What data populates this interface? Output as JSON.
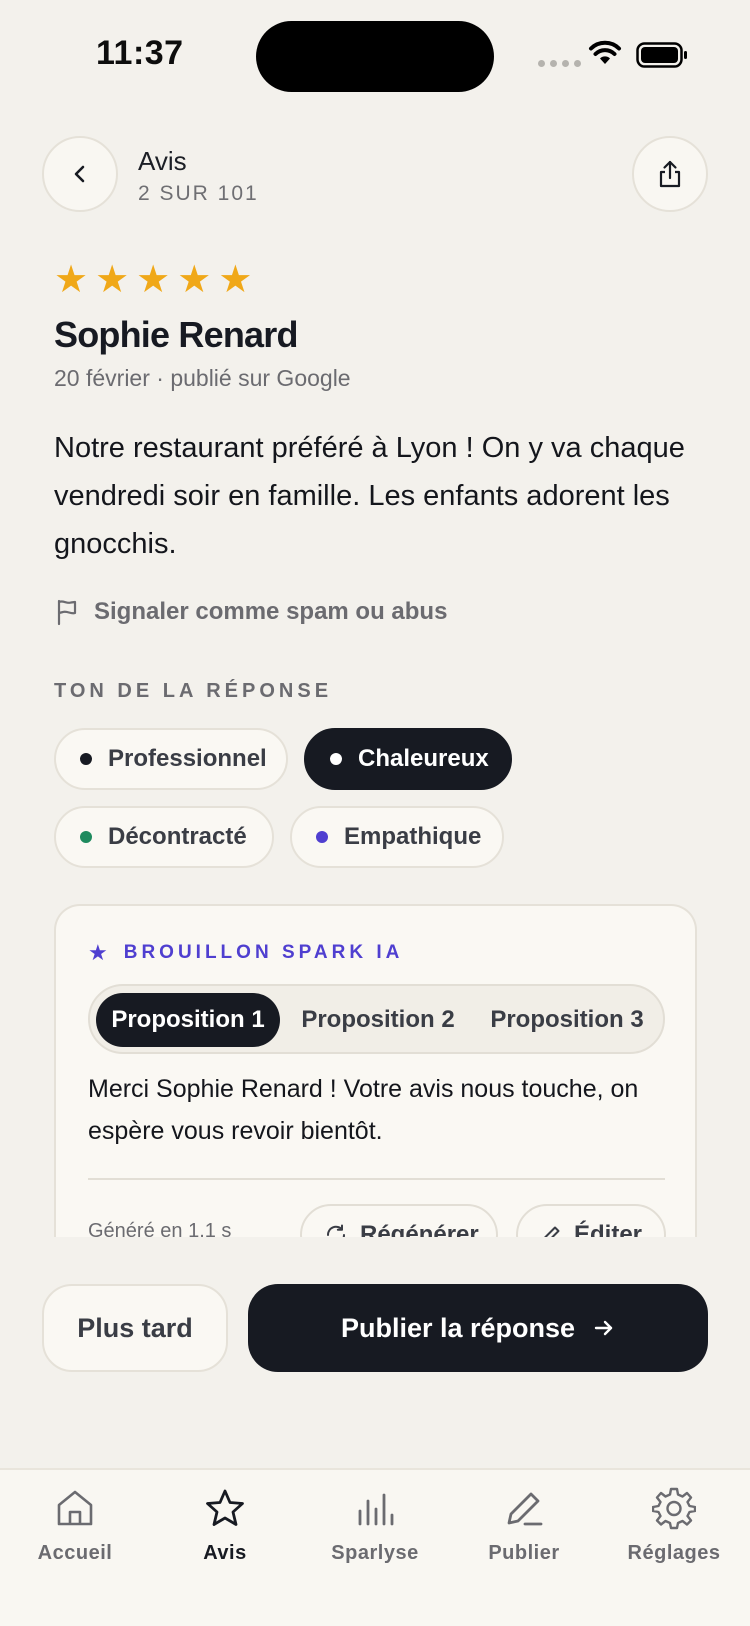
{
  "status": {
    "time": "11:37"
  },
  "header": {
    "title": "Avis",
    "subtitle": "2 SUR 101"
  },
  "review": {
    "rating": 5,
    "reviewer": "Sophie Renard",
    "meta": "20 février · publié sur Google",
    "text": "Notre restaurant préféré à Lyon ! On y va chaque vendredi soir en famille. Les enfants adorent les gnocchis.",
    "report_label": "Signaler comme spam ou abus"
  },
  "tone": {
    "title": "TON DE LA RÉPONSE",
    "options": [
      {
        "label": "Professionnel",
        "color": "#171A22",
        "selected": false
      },
      {
        "label": "Chaleureux",
        "color": "#FFFFFF",
        "selected": true
      },
      {
        "label": "Décontracté",
        "color": "#1E8A5E",
        "selected": false
      },
      {
        "label": "Empathique",
        "color": "#4F3FD0",
        "selected": false
      }
    ]
  },
  "draft": {
    "label": "BROUILLON SPARK IA",
    "tabs": [
      "Proposition 1",
      "Proposition 2",
      "Proposition 3"
    ],
    "active_tab": 0,
    "text": "Merci Sophie Renard ! Votre avis nous touche, on espère vous revoir bientôt.",
    "generated": "Généré en 1.1 s",
    "regenerate_label": "Régénérer",
    "edit_label": "Éditer"
  },
  "actions": {
    "later_label": "Plus tard",
    "publish_label": "Publier la réponse"
  },
  "tabbar": {
    "items": [
      {
        "label": "Accueil",
        "icon": "home-icon"
      },
      {
        "label": "Avis",
        "icon": "star-icon"
      },
      {
        "label": "Sparlyse",
        "icon": "bar-chart-icon"
      },
      {
        "label": "Publier",
        "icon": "pencil-icon"
      },
      {
        "label": "Réglages",
        "icon": "gear-icon"
      }
    ],
    "active": 1
  },
  "colors": {
    "accent": "#4F3FD0",
    "star": "#F0A818",
    "dark": "#171A22",
    "background": "#F3F1EC"
  }
}
